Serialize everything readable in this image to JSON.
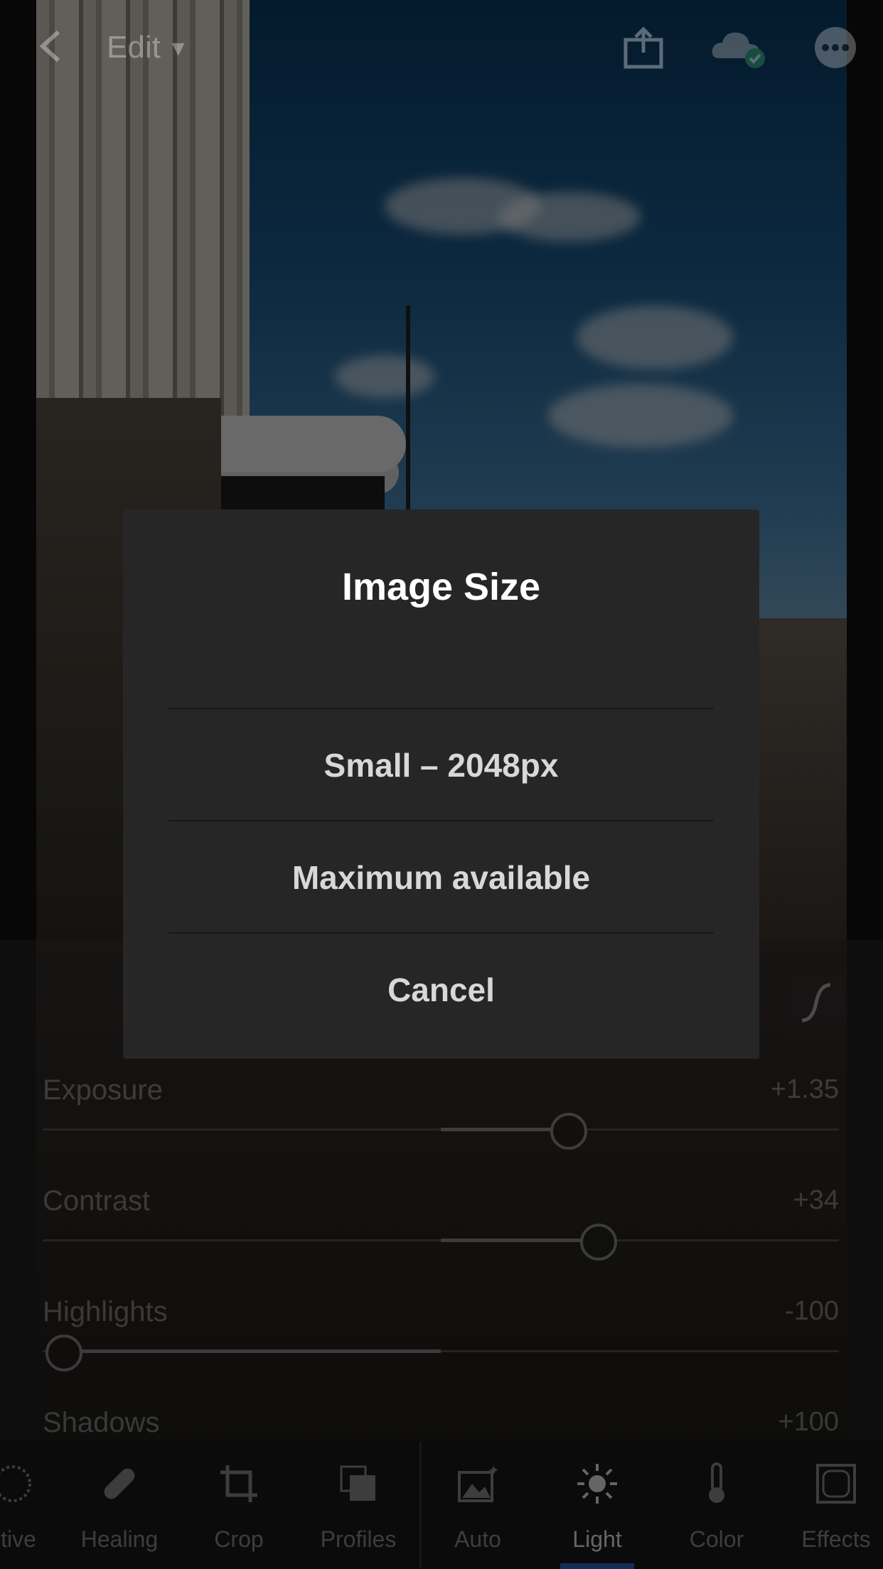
{
  "header": {
    "edit_label": "Edit"
  },
  "dialog": {
    "title": "Image Size",
    "options": [
      "Small – 2048px",
      "Maximum available"
    ],
    "cancel_label": "Cancel"
  },
  "sliders": [
    {
      "label": "Exposure",
      "value": "+1.35",
      "fraction": 0.66
    },
    {
      "label": "Contrast",
      "value": "+34",
      "fraction": 0.7
    },
    {
      "label": "Highlights",
      "value": "-100",
      "fraction": 0.0
    },
    {
      "label": "Shadows",
      "value": "+100"
    }
  ],
  "toolbar": {
    "items": [
      {
        "label": "ctive",
        "icon": "selective-icon"
      },
      {
        "label": "Healing",
        "icon": "bandage-icon"
      },
      {
        "label": "Crop",
        "icon": "crop-icon"
      },
      {
        "label": "Profiles",
        "icon": "profiles-icon"
      },
      {
        "label": "Auto",
        "icon": "auto-icon"
      },
      {
        "label": "Light",
        "icon": "sun-icon"
      },
      {
        "label": "Color",
        "icon": "thermometer-icon"
      },
      {
        "label": "Effects",
        "icon": "effects-icon"
      }
    ],
    "active": "Light"
  },
  "colors": {
    "dialog_bg": "#262626",
    "accent": "#2b6fe0"
  }
}
